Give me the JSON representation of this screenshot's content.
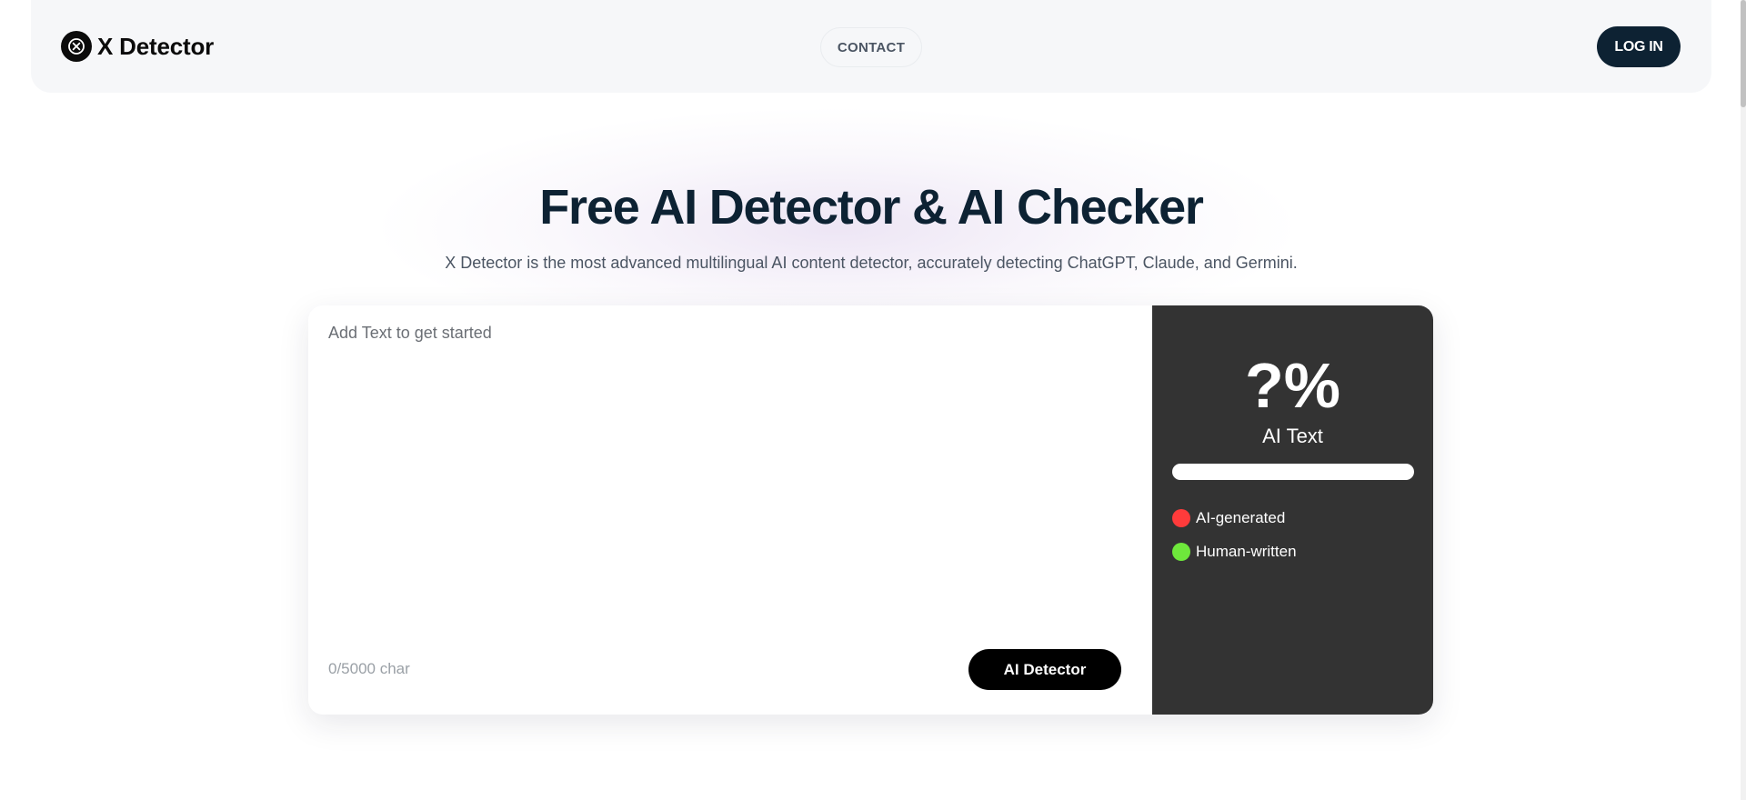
{
  "header": {
    "logo_text": "X Detector",
    "nav": {
      "contact_label": "CONTACT"
    },
    "login_label": "LOG IN"
  },
  "hero": {
    "title": "Free AI Detector & AI Checker",
    "subtitle": "X Detector is the most advanced multilingual AI content detector, accurately detecting ChatGPT, Claude, and Germini."
  },
  "editor": {
    "placeholder": "Add Text to get started",
    "value": "",
    "char_count": "0/5000 char",
    "submit_label": "AI Detector"
  },
  "result": {
    "score": "?%",
    "label": "AI Text",
    "ai_fraction": 0,
    "legend": [
      {
        "label": "AI-generated",
        "color": "#ff3b3b"
      },
      {
        "label": "Human-written",
        "color": "#6ee83b"
      }
    ]
  },
  "colors": {
    "primary_dark": "#0d2233",
    "panel_bg": "#333333",
    "ai_color": "#ff3b3b",
    "human_color": "#6ee83b"
  },
  "icons": {
    "logo": "x-circle-icon"
  }
}
